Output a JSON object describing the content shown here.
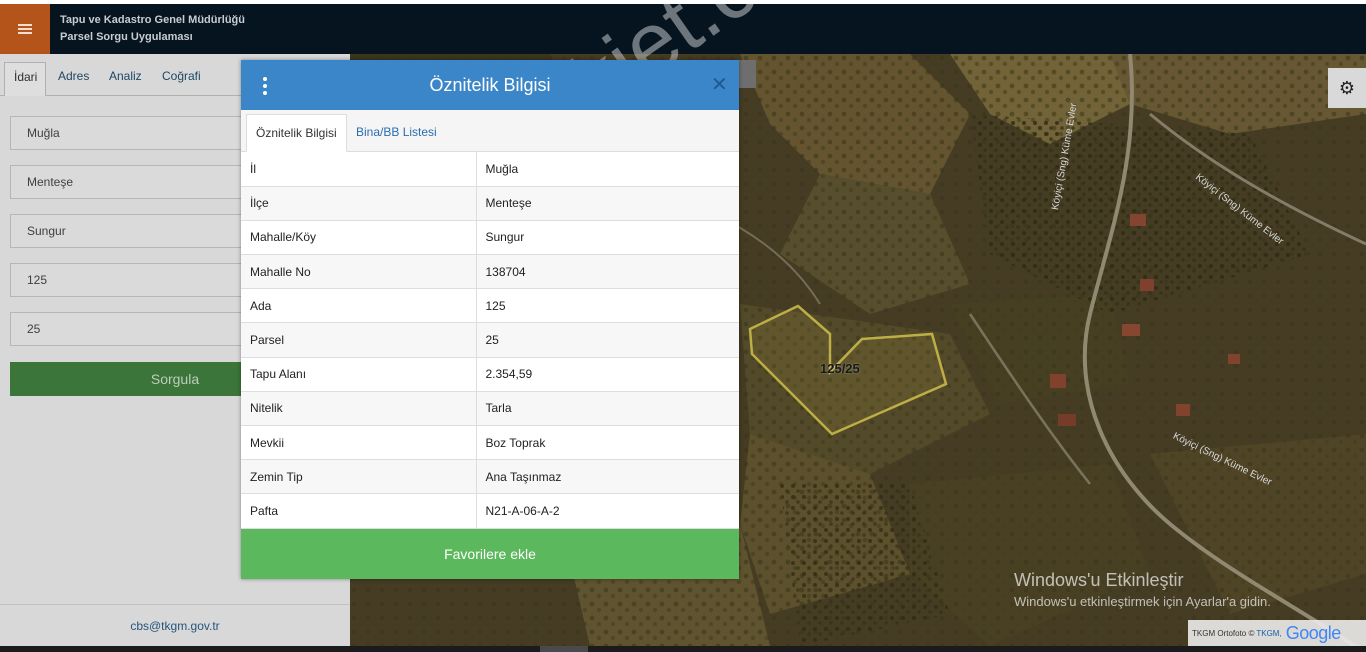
{
  "header": {
    "menu_icon": "hamburger-icon",
    "org_line1": "Tapu ve Kadastro Genel Müdürlüğü",
    "org_line2": "Parsel Sorgu Uygulaması"
  },
  "left_panel": {
    "tabs": [
      "İdari",
      "Adres",
      "Analiz",
      "Coğrafi"
    ],
    "active_tab": "İdari",
    "fields": [
      "Muğla",
      "Menteşe",
      "Sungur",
      "125",
      "25"
    ],
    "submit_label": "Sorgula",
    "contact_email": "cbs@tkgm.gov.tr"
  },
  "modal": {
    "title": "Öznitelik Bilgisi",
    "menu_icon": "kebab-icon",
    "close_icon": "close-icon",
    "tabs": [
      "Öznitelik Bilgisi",
      "Bina/BB Listesi"
    ],
    "active_tab": "Öznitelik Bilgisi",
    "rows": [
      {
        "key": "İl",
        "value": "Muğla"
      },
      {
        "key": "İlçe",
        "value": "Menteşe"
      },
      {
        "key": "Mahalle/Köy",
        "value": "Sungur"
      },
      {
        "key": "Mahalle No",
        "value": "138704"
      },
      {
        "key": "Ada",
        "value": "125"
      },
      {
        "key": "Parsel",
        "value": "25"
      },
      {
        "key": "Tapu Alanı",
        "value": "2.354,59"
      },
      {
        "key": "Nitelik",
        "value": "Tarla"
      },
      {
        "key": "Mevkii",
        "value": "Boz Toprak"
      },
      {
        "key": "Zemin Tip",
        "value": "Ana Taşınmaz"
      },
      {
        "key": "Pafta",
        "value": "N21-A-06-A-2"
      }
    ],
    "favorite_label": "Favorilere ekle"
  },
  "map": {
    "parcel_label": "125/25",
    "road_labels": [
      "Köyiçi (Sng) Küme Evler",
      "Köyiçi (Sng) Küme Evler",
      "Köyiçi (Sng) Küme Evler"
    ],
    "settings_icon": "gear-icon",
    "watermark": "emlakjet.com",
    "activation_title": "Windows'u Etkinleştir",
    "activation_hint": "Windows'u etkinleştirmek için Ayarlar'a gidin.",
    "attribution_text": "TKGM Ortofoto ©",
    "attribution_link": "TKGM,",
    "google_logo": "Google"
  },
  "colors": {
    "header_bg": "#06141f",
    "menu_btn": "#b4531a",
    "modal_header": "#3a86c8",
    "favorite_btn": "#5cb85c",
    "sorgula_btn": "#3f7d3d",
    "parcel_outline": "#c9b94a"
  }
}
